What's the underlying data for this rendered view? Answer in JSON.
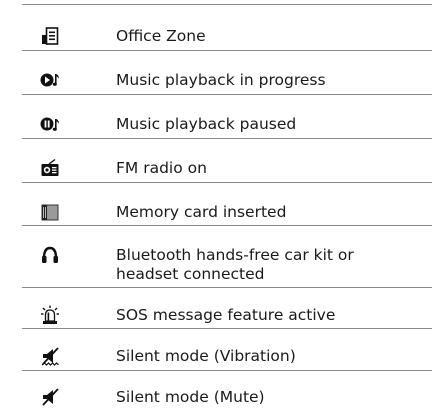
{
  "rows": [
    {
      "icon": "office-zone-icon",
      "label": "Office Zone"
    },
    {
      "icon": "music-playing-icon",
      "label": "Music playback in progress"
    },
    {
      "icon": "music-paused-icon",
      "label": "Music playback paused"
    },
    {
      "icon": "fm-radio-icon",
      "label": "FM radio on"
    },
    {
      "icon": "memory-card-icon",
      "label": "Memory card inserted"
    },
    {
      "icon": "bluetooth-headset-icon",
      "label_line1": "Bluetooth hands-free car kit or",
      "label_line2": "headset connected"
    },
    {
      "icon": "sos-siren-icon",
      "label": "SOS message feature active"
    },
    {
      "icon": "silent-vibration-icon",
      "label": "Silent mode (Vibration)"
    },
    {
      "icon": "silent-mute-icon",
      "label": "Silent mode (Mute)"
    }
  ]
}
